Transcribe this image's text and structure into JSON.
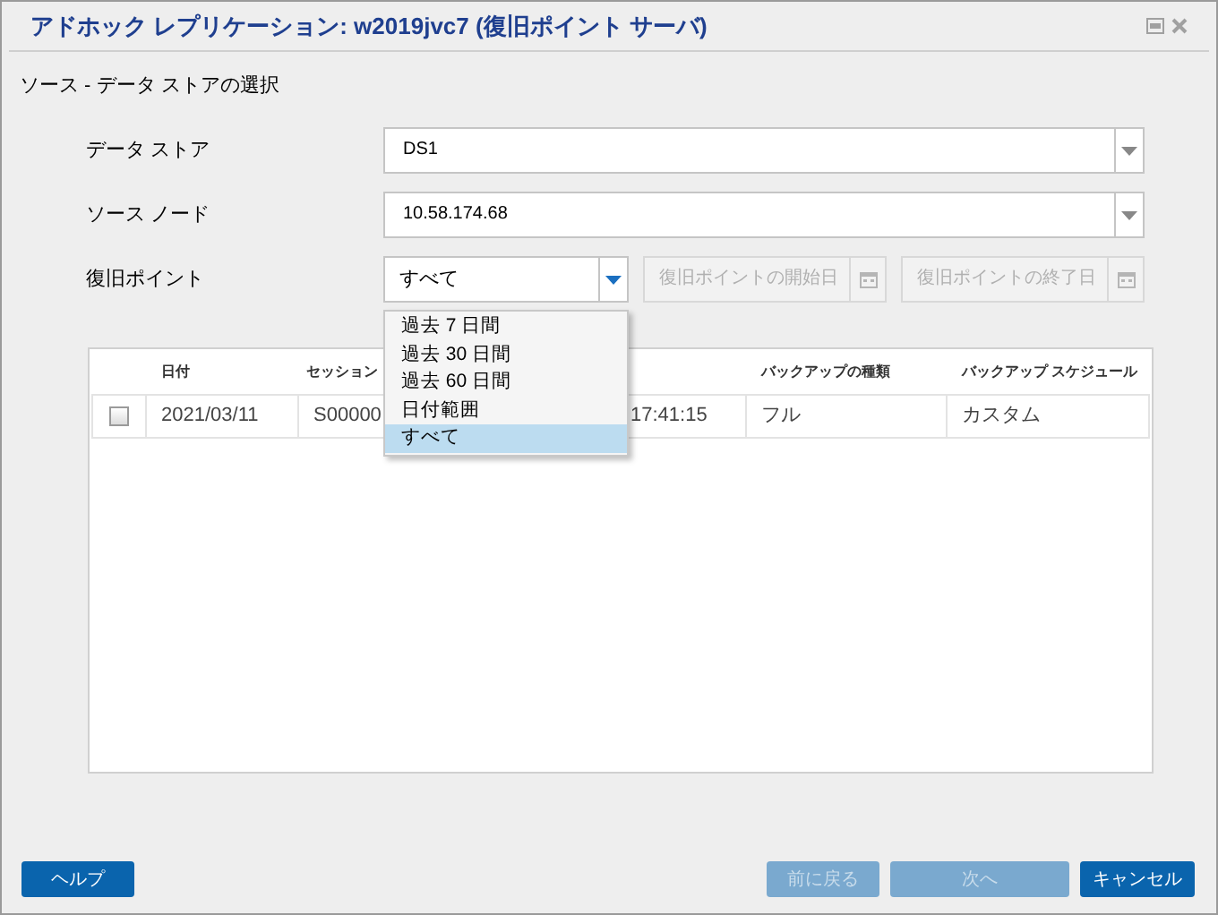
{
  "window": {
    "title": "アドホック レプリケーション: w2019jvc7 (復旧ポイント サーバ)"
  },
  "section_title": "ソース - データ ストアの選択",
  "form": [
    {
      "label": "データ ストア",
      "value": "DS1"
    },
    {
      "label": "ソース ノード",
      "value": "10.58.174.68"
    }
  ],
  "recovery_point": {
    "label": "復旧ポイント",
    "value": "すべて",
    "start_date": {
      "placeholder": "復旧ポイントの開始日",
      "disabled": true
    },
    "end_date": {
      "placeholder": "復旧ポイントの終了日",
      "disabled": true
    },
    "options": [
      {
        "label": "過去 7 日間",
        "selected": false
      },
      {
        "label": "過去 30 日間",
        "selected": false
      },
      {
        "label": "過去 60 日間",
        "selected": false
      },
      {
        "label": "日付範囲",
        "selected": false
      },
      {
        "label": "すべて",
        "selected": true
      }
    ]
  },
  "table": {
    "columns": [
      "日付",
      "セッション",
      "バックアップの種類",
      "バックアップ スケジュール"
    ],
    "rows": [
      {
        "checked": false,
        "date": "2021/03/11",
        "session": "S00000",
        "time": "17:41:15",
        "type": "フル",
        "schedule": "カスタム"
      }
    ]
  },
  "buttons": [
    {
      "label": "ヘルプ",
      "disabled": false
    },
    {
      "label": "前に戻る",
      "disabled": true
    },
    {
      "label": "次へ",
      "disabled": true
    },
    {
      "label": "キャンセル",
      "disabled": false
    }
  ]
}
